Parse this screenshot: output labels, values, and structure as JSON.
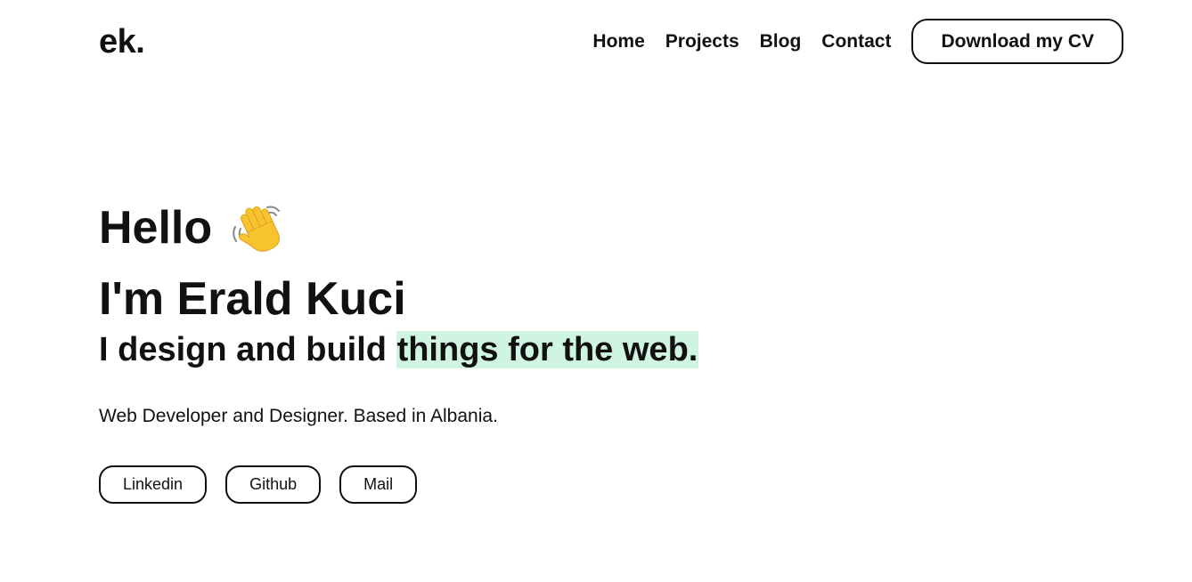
{
  "header": {
    "logo": "ek.",
    "nav": {
      "home": "Home",
      "projects": "Projects",
      "blog": "Blog",
      "contact": "Contact"
    },
    "cv_button": "Download my CV"
  },
  "hero": {
    "greeting": "Hello",
    "greeting_icon": "waving-hand-icon",
    "name": "I'm Erald Kuci",
    "tagline_plain": "I design and build ",
    "tagline_highlight": "things for the web.",
    "subtitle": "Web Developer and Designer. Based in Albania.",
    "socials": {
      "linkedin": "Linkedin",
      "github": "Github",
      "mail": "Mail"
    }
  },
  "colors": {
    "text": "#111111",
    "background": "#ffffff",
    "highlight": "#cff5e2",
    "wave_fill": "#f7c32e"
  }
}
